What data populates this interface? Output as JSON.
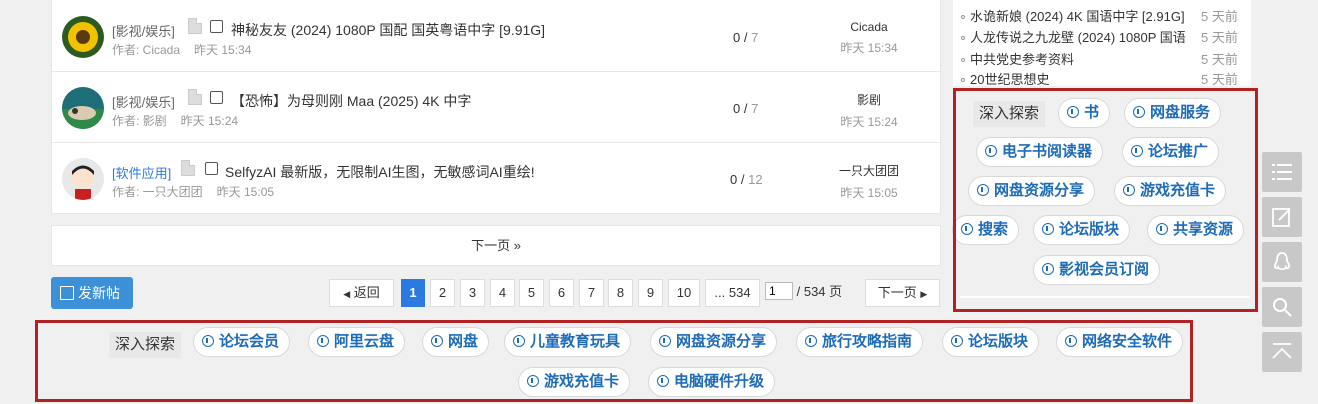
{
  "threads": [
    {
      "category": "[影视/娱乐]",
      "title": "神秘友友 (2024) 1080P 国配 国英粤语中字 [9.91G]",
      "author": "作者: Cicada",
      "time": "昨天 15:34",
      "replies": "0",
      "sep": "/",
      "views": "7",
      "last_user": "Cicada",
      "last_time": "昨天 15:34"
    },
    {
      "category": "[影视/娱乐]",
      "title": "【恐怖】为母则刚 Maa (2025) 4K 中字",
      "author": "作者: 影剧",
      "time": "昨天 15:24",
      "replies": "0",
      "sep": "/",
      "views": "7",
      "last_user": "影剧",
      "last_time": "昨天 15:24"
    },
    {
      "category": "[软件应用]",
      "title": "SelfyzAI 最新版，无限制AI生图，无敏感词AI重绘!",
      "author": "作者: 一只大团团",
      "time": "昨天 15:05",
      "replies": "0",
      "sep": "/",
      "views": "12",
      "last_user": "一只大团团",
      "last_time": "昨天 15:05"
    }
  ],
  "next_page_bar": "下一页 »",
  "post_button": "发新帖",
  "pagination": {
    "back": "返回",
    "pages": [
      "1",
      "2",
      "3",
      "4",
      "5",
      "6",
      "7",
      "8",
      "9",
      "10"
    ],
    "current": "1",
    "last": "... 534",
    "input_value": "1",
    "total": "/ 534 页",
    "next": "下一页"
  },
  "sidebar_list": [
    {
      "title": "水诡新娘 (2024) 4K 国语中字 [2.91G]",
      "ago": "5 天前"
    },
    {
      "title": "人龙传说之九龙壁 (2024) 1080P 国语",
      "ago": "5 天前"
    },
    {
      "title": "中共党史参考资料",
      "ago": "5 天前"
    },
    {
      "title": "20世纪思想史",
      "ago": "5 天前"
    }
  ],
  "side_explore": {
    "label": "深入探索",
    "tags": [
      "书",
      "网盘服务",
      "电子书阅读器",
      "论坛推广",
      "网盘资源分享",
      "游戏充值卡",
      "搜索",
      "论坛版块",
      "共享资源",
      "影视会员订阅"
    ]
  },
  "bottom_explore": {
    "label": "深入探索",
    "tags": [
      "论坛会员",
      "阿里云盘",
      "网盘",
      "儿童教育玩具",
      "网盘资源分享",
      "旅行攻略指南",
      "论坛版块",
      "网络安全软件",
      "游戏充值卡",
      "电脑硬件升级"
    ]
  },
  "toolbar": {
    "icons": [
      "list-icon",
      "edit-icon",
      "qq-icon",
      "search-icon",
      "back-to-top-icon"
    ]
  },
  "colors": {
    "accent": "#2a7ae2",
    "tag_text": "#1e6bb8",
    "highlight_border": "#b22222",
    "post_button": "#3b90d8"
  }
}
